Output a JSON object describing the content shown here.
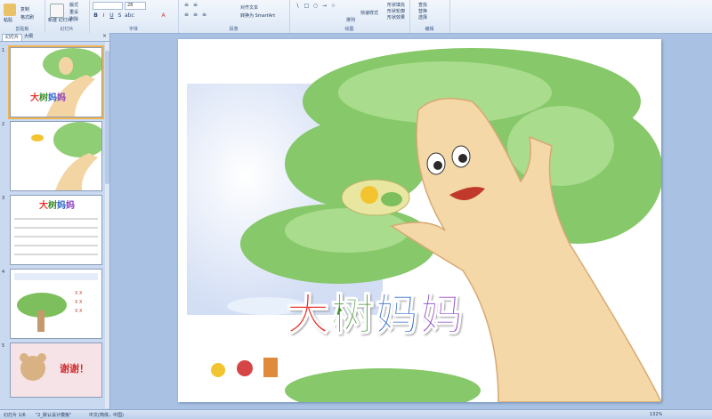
{
  "ribbon": {
    "groups": {
      "clipboard": "剪贴板",
      "slides": "幻灯片",
      "font": "字体",
      "paragraph": "段落",
      "drawing": "绘图",
      "editing": "编辑"
    },
    "buttons": {
      "paste": "粘贴",
      "copy": "复制",
      "format_painter": "格式刷",
      "new_slide": "新建\n幻灯片",
      "layout": "版式",
      "reset": "重设",
      "delete": "删除",
      "font_size": "28",
      "align_text": "对齐文本",
      "smartart": "转换为 SmartArt",
      "arrange": "排列",
      "quick_styles": "快速样式",
      "shape_fill": "形状填充",
      "shape_outline": "形状轮廓",
      "shape_effects": "形状效果",
      "find": "查找",
      "replace": "替换",
      "select": "选择"
    }
  },
  "panel": {
    "tabs": [
      "幻灯片",
      "大纲"
    ],
    "slides": [
      {
        "num": "1",
        "title": "大树妈妈",
        "selected": true
      },
      {
        "num": "2",
        "title": ""
      },
      {
        "num": "3",
        "title": "大树妈妈"
      },
      {
        "num": "4",
        "title": ""
      },
      {
        "num": "5",
        "title": "谢谢！"
      }
    ]
  },
  "slide": {
    "title_chars": [
      "大",
      "树",
      "妈",
      "妈"
    ],
    "title_colors": [
      "#e8342d",
      "#3b8f2c",
      "#2b64c8",
      "#8a3bc3"
    ]
  },
  "status": {
    "slide_pos": "幻灯片 1/6",
    "theme": "\"2_默认设计模板\"",
    "lang": "中文(简体，中国)",
    "zoom": "132%"
  },
  "colors": {
    "ribbon_bg": "#dde8f6",
    "workspace": "#a9c2e3",
    "selected_outline": "#f2b34a"
  }
}
